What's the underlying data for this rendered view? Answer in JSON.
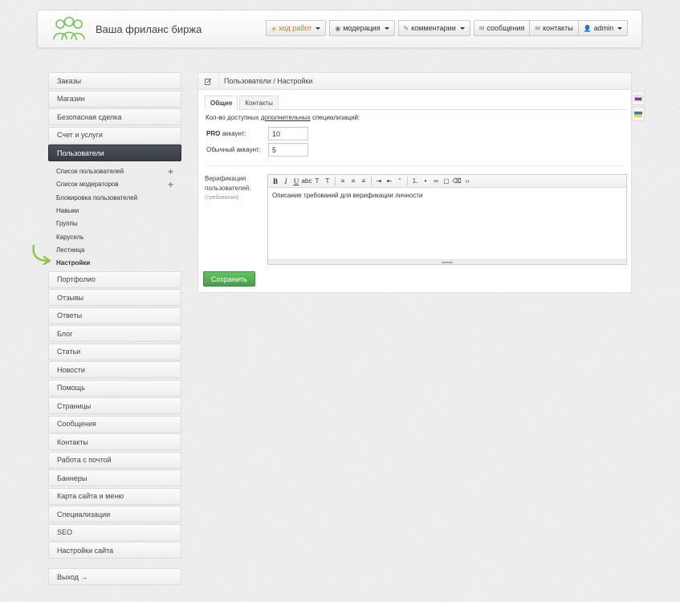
{
  "header": {
    "site_name": "Ваша фриланс биржа",
    "nav": [
      {
        "label": "ход работ",
        "icon": "shield-icon",
        "dropdown": true
      },
      {
        "label": "модерация",
        "icon": "eye-icon",
        "dropdown": true
      },
      {
        "label": "комментарии",
        "icon": "pencil-icon",
        "dropdown": true
      },
      {
        "label": "сообщения",
        "icon": "envelope-icon",
        "dropdown": false
      },
      {
        "label": "контакты",
        "icon": "envelope-icon",
        "dropdown": false
      },
      {
        "label": "admin",
        "icon": "user-icon",
        "dropdown": true
      }
    ]
  },
  "sidebar": {
    "top_items": [
      "Заказы",
      "Магазин",
      "Безопасная сделка",
      "Счет и услуги"
    ],
    "active_item": "Пользователи",
    "subitems": [
      {
        "label": "Список пользователей",
        "plus": true
      },
      {
        "label": "Список модераторов",
        "plus": true
      },
      {
        "label": "Блокировка пользователей",
        "plus": false
      },
      {
        "label": "Навыки",
        "plus": false
      },
      {
        "label": "Группы",
        "plus": false
      },
      {
        "label": "Карусель",
        "plus": false
      },
      {
        "label": "Лестница",
        "plus": false
      },
      {
        "label": "Настройки",
        "plus": false
      }
    ],
    "bottom_items": [
      "Портфолио",
      "Отзывы",
      "Ответы",
      "Блог",
      "Статьи",
      "Новости",
      "Помощь",
      "Страницы",
      "Сообщения",
      "Контакты",
      "Работа с почтой",
      "Баннеры",
      "Карта сайта и меню",
      "Специализации",
      "SEO",
      "Настройки сайта"
    ],
    "logout": "Выход →"
  },
  "main": {
    "breadcrumb": "Пользователи / Настройки",
    "tabs": [
      "Общие",
      "Контакты"
    ],
    "lead_prefix": "Кол-во доступных ",
    "lead_link": "дополнительных",
    "lead_suffix": " специализаций:",
    "pro_label_bold": "PRO",
    "pro_label_rest": " аккаунт:",
    "pro_value": "10",
    "regular_label": "Обычный аккаунт:",
    "regular_value": "5",
    "verification_label": "Верификация пользователей:",
    "verification_note": "(требования)",
    "editor_text": "Описание требований для верификации личности",
    "save_label": "Сохранить"
  },
  "colors": {
    "accent_green": "#5cb85c",
    "active_dark": "#3c4248",
    "warn_orange": "#c47b1c"
  }
}
